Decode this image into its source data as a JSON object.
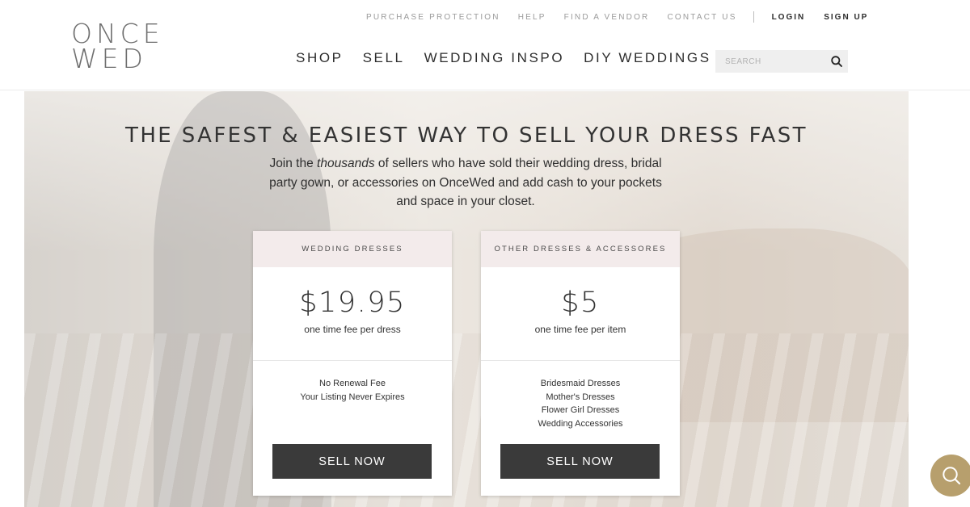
{
  "header": {
    "logo": [
      "ONCE",
      "WED"
    ],
    "util_links": [
      "PURCHASE PROTECTION",
      "HELP",
      "FIND A VENDOR",
      "CONTACT US"
    ],
    "account_links": [
      "LOGIN",
      "SIGN UP"
    ],
    "main_nav": [
      "SHOP",
      "SELL",
      "WEDDING INSPO",
      "DIY WEDDINGS"
    ],
    "search_placeholder": "SEARCH",
    "search_icon": "search-icon"
  },
  "hero": {
    "headline": "THE SAFEST & EASIEST WAY TO SELL YOUR DRESS FAST",
    "intro_before": "Join the ",
    "intro_em": "thousands",
    "intro_after": " of sellers who have sold their wedding dress, bridal party gown, or accessories on OnceWed and add cash to your pockets and space in your closet."
  },
  "cards": [
    {
      "title": "WEDDING DRESSES",
      "price": "$19.95",
      "fee": "one time fee per dress",
      "features": [
        "No Renewal Fee",
        "Your Listing Never Expires"
      ],
      "button": "SELL NOW"
    },
    {
      "title": "OTHER DRESSES & ACCESSORES",
      "price": "$5",
      "fee": "one time fee per item",
      "features": [
        "Bridesmaid Dresses",
        "Mother's Dresses",
        "Flower Girl Dresses",
        "Wedding Accessories"
      ],
      "button": "SELL NOW"
    }
  ],
  "chat": {
    "icon": "search-icon",
    "color": "#b79f6d"
  }
}
